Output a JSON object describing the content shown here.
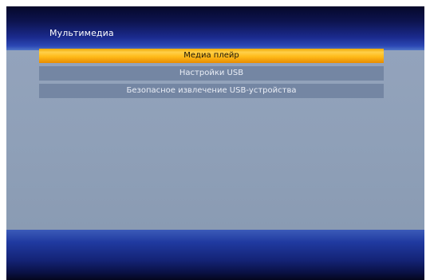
{
  "header": {
    "title": "Мультимедиа"
  },
  "menu": {
    "items": [
      {
        "label": "Медиа плейр",
        "selected": true
      },
      {
        "label": "Настройки USB",
        "selected": false
      },
      {
        "label": "Безопасное извлечение USB-устройства",
        "selected": false
      }
    ]
  },
  "colors": {
    "highlight": "#ffc21a",
    "item_background": "#7486a3",
    "content_background": "#8fa0b8",
    "header_dark": "#0d1450"
  }
}
